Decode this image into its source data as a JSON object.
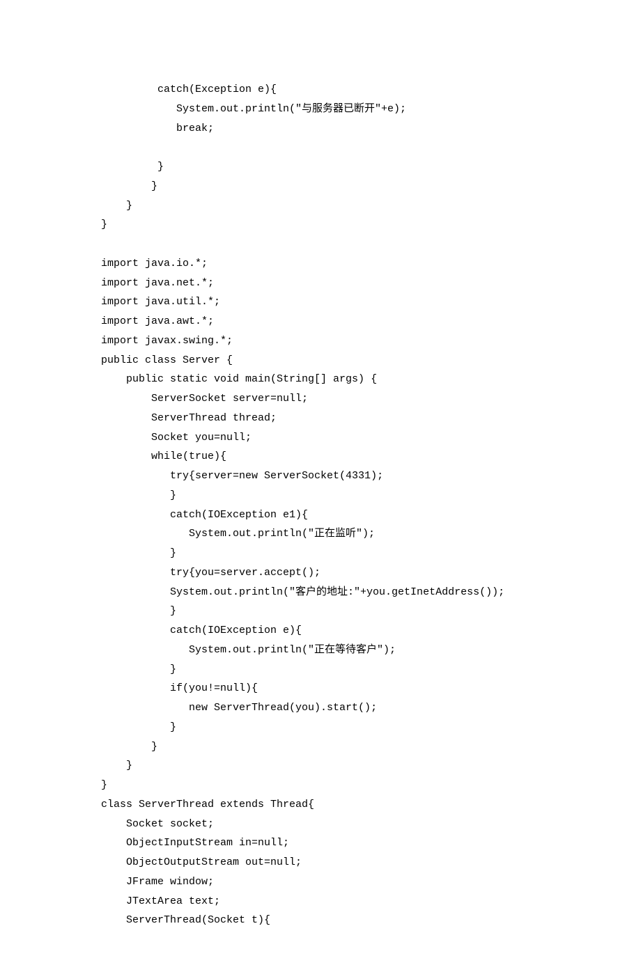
{
  "code": {
    "lines": [
      "         catch(Exception e){",
      "            System.out.println(\"与服务器已断开\"+e);",
      "            break;",
      "",
      "         }",
      "        }",
      "    }",
      "}",
      "",
      "import java.io.*;",
      "import java.net.*;",
      "import java.util.*;",
      "import java.awt.*;",
      "import javax.swing.*;",
      "public class Server {",
      "    public static void main(String[] args) {",
      "        ServerSocket server=null;",
      "        ServerThread thread;",
      "        Socket you=null;",
      "        while(true){",
      "           try{server=new ServerSocket(4331);",
      "           }",
      "           catch(IOException e1){",
      "              System.out.println(\"正在监听\");",
      "           }",
      "           try{you=server.accept();",
      "           System.out.println(\"客户的地址:\"+you.getInetAddress());",
      "           }",
      "           catch(IOException e){",
      "              System.out.println(\"正在等待客户\");",
      "           }",
      "           if(you!=null){",
      "              new ServerThread(you).start();",
      "           }",
      "        }",
      "    }",
      "}",
      "class ServerThread extends Thread{",
      "    Socket socket;",
      "    ObjectInputStream in=null;",
      "    ObjectOutputStream out=null;",
      "    JFrame window;",
      "    JTextArea text;",
      "    ServerThread(Socket t){"
    ]
  }
}
